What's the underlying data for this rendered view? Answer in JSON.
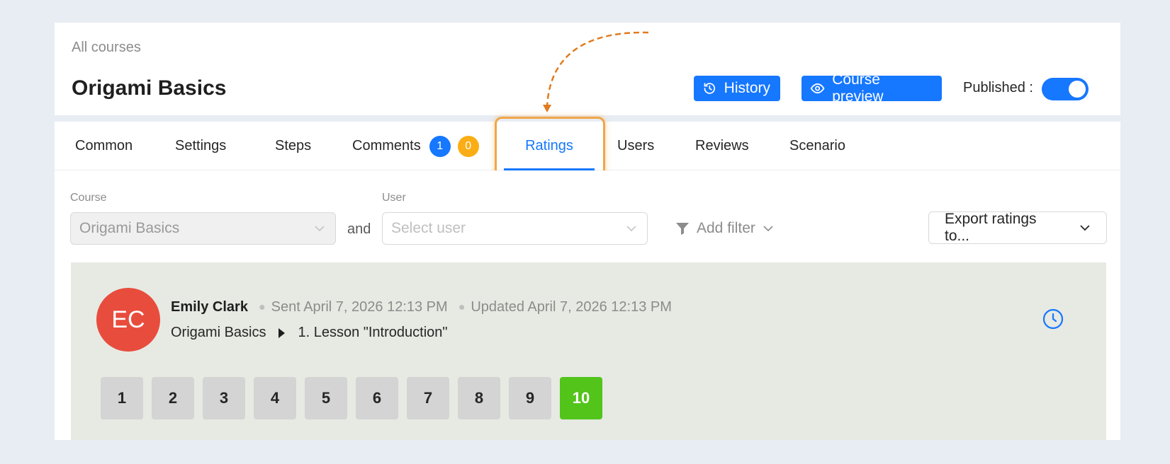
{
  "header": {
    "breadcrumb": "All courses",
    "title": "Origami Basics",
    "history_label": "History",
    "preview_label": "Course preview",
    "published_label": "Published :",
    "published": true
  },
  "tabs": [
    {
      "label": "Common"
    },
    {
      "label": "Settings"
    },
    {
      "label": "Steps"
    },
    {
      "label": "Comments",
      "badges": [
        "1",
        "0"
      ]
    },
    {
      "label": "Ratings",
      "active": true
    },
    {
      "label": "Users"
    },
    {
      "label": "Reviews"
    },
    {
      "label": "Scenario"
    }
  ],
  "filters": {
    "course_label": "Course",
    "course_value": "Origami Basics",
    "and_text": "and",
    "user_label": "User",
    "user_placeholder": "Select user",
    "add_filter_label": "Add filter",
    "export_label": "Export ratings to..."
  },
  "rating": {
    "initials": "EC",
    "author": "Emily Clark",
    "sent": "Sent April 7, 2026 12:13 PM",
    "updated": "Updated April 7, 2026 12:13 PM",
    "course": "Origami Basics",
    "lesson": "1. Lesson \"Introduction\"",
    "scores": [
      "1",
      "2",
      "3",
      "4",
      "5",
      "6",
      "7",
      "8",
      "9",
      "10"
    ],
    "selected_score": "10"
  },
  "colors": {
    "primary": "#1677ff",
    "badge_orange": "#faad14",
    "avatar": "#e84c3d",
    "selected_score": "#52c41a",
    "highlight": "#f0a64a"
  }
}
